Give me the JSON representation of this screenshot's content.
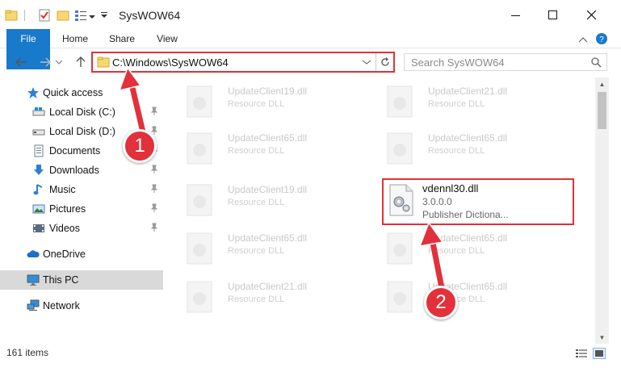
{
  "window": {
    "title": "SysWOW64"
  },
  "ribbon": {
    "tabs": [
      "File",
      "Home",
      "Share",
      "View"
    ]
  },
  "address_bar": {
    "path": "C:\\Windows\\SysWOW64"
  },
  "search": {
    "placeholder": "Search SysWOW64"
  },
  "sidebar": {
    "items": [
      {
        "label": "Quick access",
        "icon": "star-icon"
      },
      {
        "label": "Local Disk (C:)",
        "icon": "drive-icon",
        "pinned": true
      },
      {
        "label": "Local Disk (D:)",
        "icon": "drive-icon",
        "pinned": true
      },
      {
        "label": "Documents",
        "icon": "documents-icon",
        "pinned": true
      },
      {
        "label": "Downloads",
        "icon": "download-arrow-icon",
        "pinned": true
      },
      {
        "label": "Music",
        "icon": "music-note-icon",
        "pinned": true
      },
      {
        "label": "Pictures",
        "icon": "pictures-icon",
        "pinned": true
      },
      {
        "label": "Videos",
        "icon": "videos-icon",
        "pinned": true
      },
      {
        "label": "OneDrive",
        "icon": "cloud-icon"
      },
      {
        "label": "This PC",
        "icon": "computer-icon",
        "selected": true
      },
      {
        "label": "Network",
        "icon": "network-icon"
      }
    ]
  },
  "files": [
    {
      "name": "UpdateClient19.dll",
      "type": "Resource DLL"
    },
    {
      "name": "UpdateClient21.dll",
      "type": "Resource DLL"
    },
    {
      "name": "UpdateClient65.dll",
      "type": "Resource DLL"
    },
    {
      "name": "UpdateClient65.dll",
      "type": "Resource DLL"
    },
    {
      "name": "UpdateClient19.dll",
      "type": "Resource DLL"
    },
    {
      "name": "UpdateClient65.dll",
      "type": "Resource DLL"
    },
    {
      "name": "UpdateClient65.dll",
      "type": "Resource DLL"
    },
    {
      "name": "UpdateClient21.dll",
      "type": "Resource DLL"
    },
    {
      "name": "UpdateClient65.dll",
      "type": "Resource DLL"
    }
  ],
  "highlighted_file": {
    "name": "vdennl30.dll",
    "version": "3.0.0.0",
    "publisher": "Publisher  Dictiona..."
  },
  "status_bar": {
    "count": "161 items"
  },
  "annotations": {
    "step1": "1",
    "step2": "2",
    "color": "#e2313b"
  }
}
